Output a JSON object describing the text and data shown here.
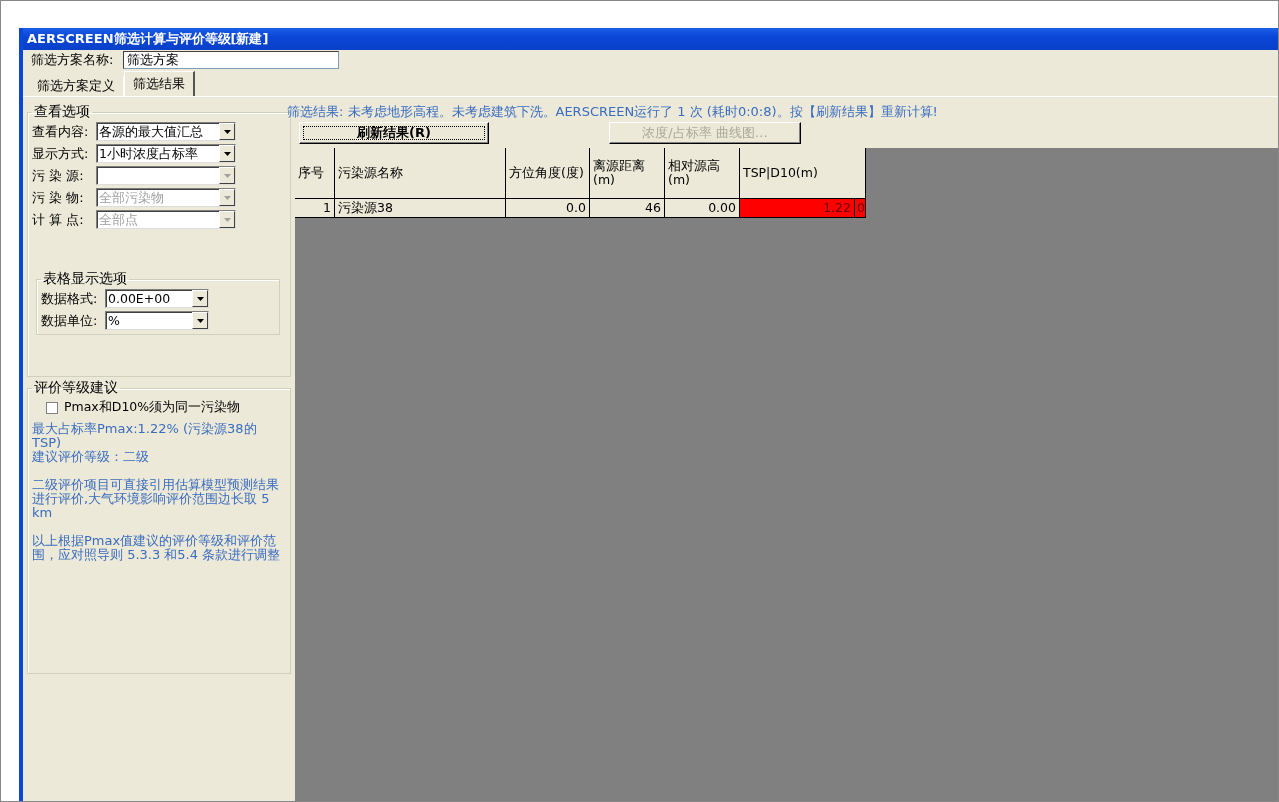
{
  "window": {
    "title": "AERSCREEN筛选计算与评价等级[新建]"
  },
  "scheme_name": {
    "label": "筛选方案名称:",
    "value": "筛选方案"
  },
  "tabs": [
    {
      "label": "筛选方案定义",
      "selected": false
    },
    {
      "label": "筛选结果",
      "selected": true
    }
  ],
  "view_options": {
    "title": "查看选项",
    "fields": [
      {
        "label": "查看内容:",
        "value": "各源的最大值汇总",
        "disabled": false
      },
      {
        "label": "显示方式:",
        "value": "1小时浓度占标率",
        "disabled": false
      },
      {
        "label": "污 染 源:",
        "disabled": true
      },
      {
        "label": "污 染 物:",
        "value": "全部污染物",
        "disabled": true
      },
      {
        "label": "计 算 点:",
        "value": "全部点",
        "disabled": true
      }
    ]
  },
  "table_options": {
    "title": "表格显示选项",
    "fields": [
      {
        "label": "数据格式:",
        "value": "0.00E+00",
        "disabled": false
      },
      {
        "label": "数据单位:",
        "value": "%",
        "disabled": false
      }
    ]
  },
  "grade_advice": {
    "title": "评价等级建议",
    "checkbox": {
      "label": "Pmax和D10%须为同一污染物",
      "checked": false
    },
    "paragraphs": [
      "最大占标率Pmax:1.22% (污染源38的 TSP)\n建议评价等级：二级",
      "二级评价项目可直接引用估算模型预测结果进行评价,大气环境影响评价范围边长取 5 km",
      "以上根据Pmax值建议的评价等级和评价范围，应对照导则 5.3.3 和5.4 条款进行调整"
    ]
  },
  "status_text": "筛选结果: 未考虑地形高程。未考虑建筑下洗。AERSCREEN运行了 1 次 (耗时0:0:8)。按【刷新结果】重新计算!",
  "buttons": [
    {
      "label": "刷新结果(R)",
      "disabled": false
    },
    {
      "label": "浓度/占标率 曲线图…",
      "disabled": true
    }
  ],
  "table": {
    "columns": [
      "序号",
      "污染源名称",
      "方位角度(度)",
      "离源距离(m)",
      "相对源高(m)",
      "TSP|D10(m)"
    ],
    "rows": [
      {
        "cells": [
          "1",
          "污染源38",
          "0.0",
          "46",
          "0.00",
          "1.22",
          "0"
        ],
        "color": "#ff0000"
      }
    ]
  }
}
